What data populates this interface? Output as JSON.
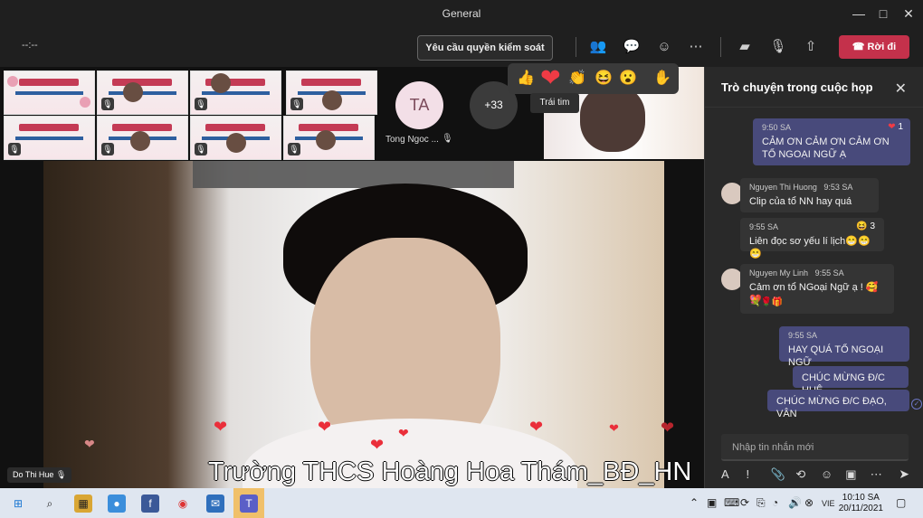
{
  "window": {
    "title": "General"
  },
  "toolbar": {
    "timer": "--:--",
    "control_button": "Yêu cầu quyền kiểm soát",
    "leave_button": "Rời đi"
  },
  "participants": {
    "avatar_initials": "TA",
    "avatar_name": "Tong Ngoc ...",
    "overflow": "+33"
  },
  "reactions": {
    "tooltip": "Trái tim"
  },
  "video": {
    "caption": "Trường THCS Hoàng Hoa Thám_BĐ_HN",
    "name_tag": "Do Thi Hue"
  },
  "chat": {
    "title": "Trò chuyện trong cuộc họp",
    "messages": [
      {
        "time": "9:50 SA",
        "text": "CẢM ƠN CẢM ƠN CẢM ƠN TỔ NGOẠI NGỮ Ạ",
        "reaction_count": "1"
      },
      {
        "sender": "Nguyen Thi Huong",
        "time": "9:53 SA",
        "text": "Clip của tổ NN hay quá"
      },
      {
        "time": "9:55 SA",
        "text": "Liên đọc sơ yếu lí lịch😁😁😁",
        "reaction_count": "3"
      },
      {
        "sender": "Nguyen My Linh",
        "time": "9:55 SA",
        "text": "Cảm ơn tổ NGoại Ngữ ạ ! 🥰❤️",
        "extra": "💐🌹🎁"
      },
      {
        "time": "9:55 SA",
        "text": "HAY QUÁ TỔ NGOẠI NGỮ"
      },
      {
        "text": "CHÚC MỪNG Đ/C HUỆ"
      },
      {
        "text": "CHÚC MỪNG Đ/C ĐẠO, VÂN"
      }
    ],
    "input_placeholder": "Nhập tin nhắn mới"
  },
  "taskbar": {
    "language": "VIE",
    "time": "10:10 SA",
    "date": "20/11/2021"
  }
}
